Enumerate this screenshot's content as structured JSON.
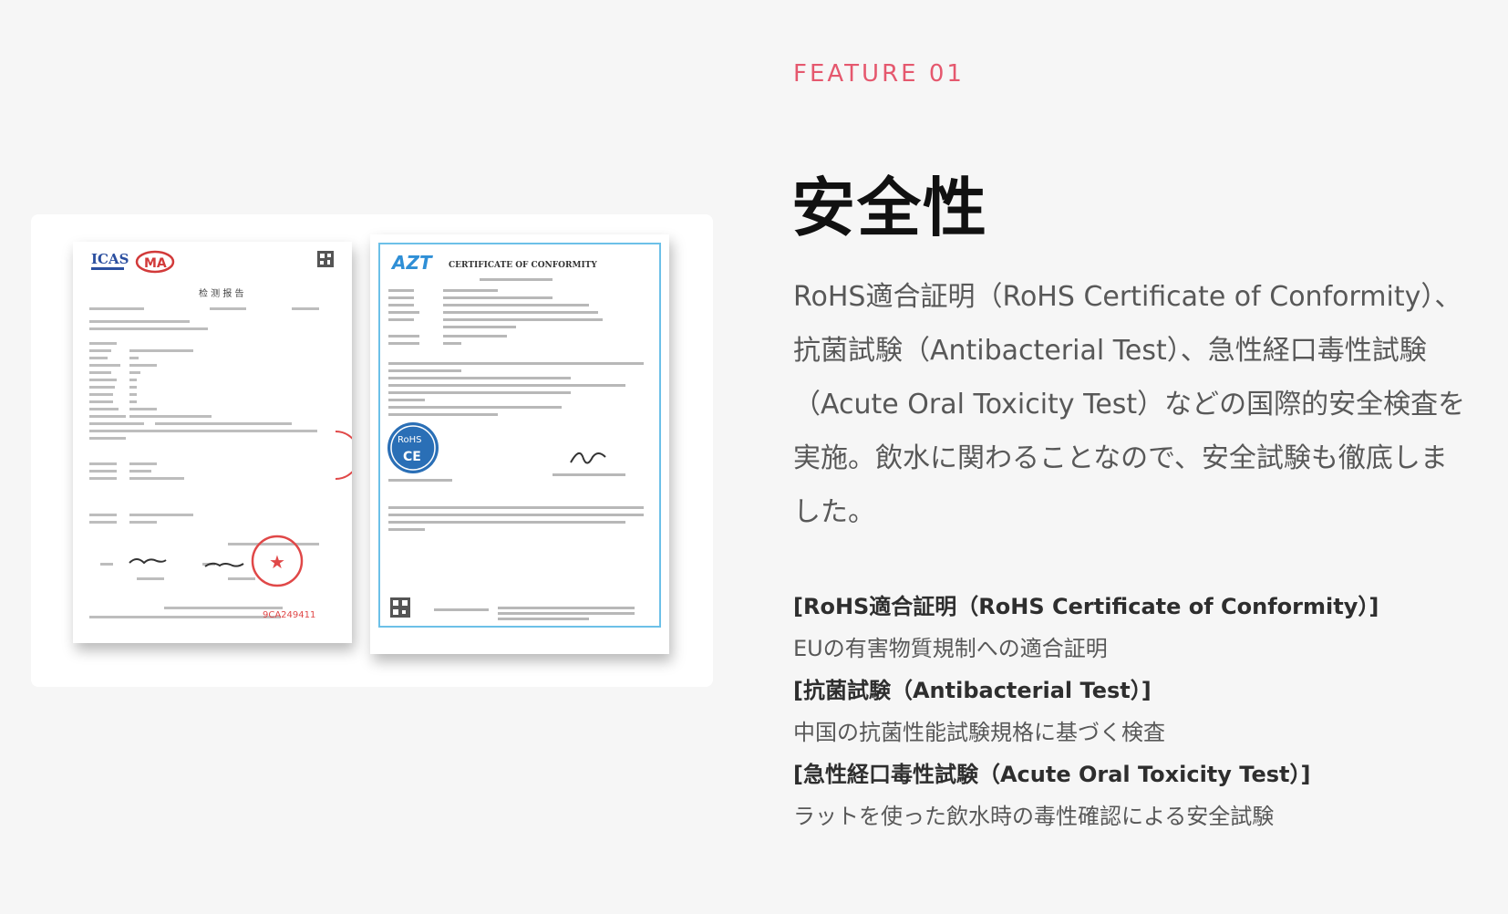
{
  "feature": {
    "label": "FEATURE 01",
    "title": "安全性",
    "description": "RoHS適合証明（RoHS Certificate of Conformity）、抗菌試験（Antibacterial Test）、急性経口毒性試験（Acute Oral Toxicity Test）などの国際的安全検査を実施。飲水に関わることなので、安全試験も徹底しました。"
  },
  "certifications": [
    {
      "heading": "[RoHS適合証明（RoHS Certificate of Conformity）]",
      "description": "EUの有害物質規制への適合証明"
    },
    {
      "heading": "[抗菌試験（Antibacterial Test）]",
      "description": "中国の抗菌性能試験規格に基づく検査"
    },
    {
      "heading": "[急性経口毒性試験（Acute Oral Toxicity Test）]",
      "description": "ラットを使った飲水時の毒性確認による安全試験"
    }
  ],
  "documents": {
    "left": {
      "logo_text": "ICAS",
      "mark_text": "MA",
      "title": "检 测 报 告",
      "stamp_code": "9CA249411"
    },
    "right": {
      "logo_text": "AZT",
      "title": "CERTIFICATE OF CONFORMITY",
      "badge_text": "RoHS"
    }
  },
  "colors": {
    "background": "#f6f6f6",
    "accent": "#e5586e",
    "title": "#111111",
    "body_text": "#585858",
    "certificate_border": "#6cc0e8",
    "stamp_red": "#e04848"
  }
}
